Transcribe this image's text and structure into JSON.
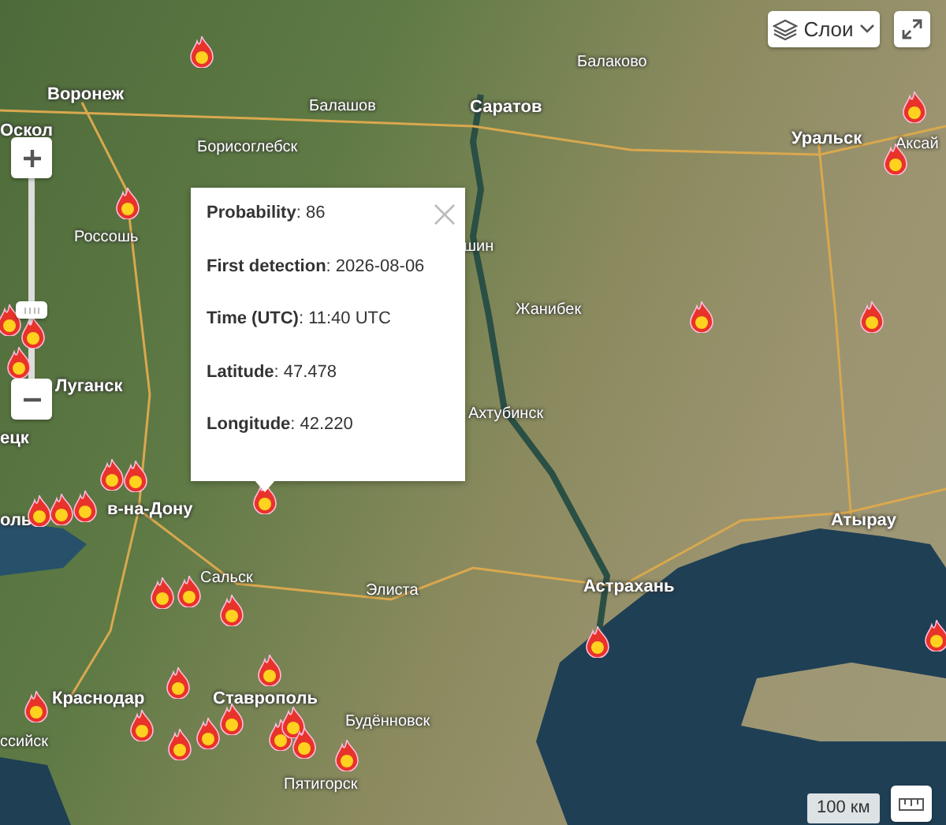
{
  "map": {
    "labels": [
      {
        "text": "Воронеж",
        "kind": "major"
      },
      {
        "text": "Оскол",
        "kind": "major"
      },
      {
        "text": "Балашов",
        "kind": "minor"
      },
      {
        "text": "Борисоглебск",
        "kind": "minor"
      },
      {
        "text": "Саратов",
        "kind": "major"
      },
      {
        "text": "Балаково",
        "kind": "minor"
      },
      {
        "text": "Уральск",
        "kind": "major"
      },
      {
        "text": "Аксай",
        "kind": "minor"
      },
      {
        "text": "Россошь",
        "kind": "minor"
      },
      {
        "text": "Луганск",
        "kind": "major"
      },
      {
        "text": "шин",
        "kind": "minor"
      },
      {
        "text": "Жанибек",
        "kind": "minor"
      },
      {
        "text": "Ахтубинск",
        "kind": "minor"
      },
      {
        "text": "Атырау",
        "kind": "major"
      },
      {
        "text": "Астрахань",
        "kind": "major"
      },
      {
        "text": "ецк",
        "kind": "major"
      },
      {
        "text": "оль",
        "kind": "major"
      },
      {
        "text": "в-на-Дону",
        "kind": "major"
      },
      {
        "text": "Сальск",
        "kind": "minor"
      },
      {
        "text": "Элиста",
        "kind": "minor"
      },
      {
        "text": "Краснодар",
        "kind": "major"
      },
      {
        "text": "ссийск",
        "kind": "minor"
      },
      {
        "text": "Ставрополь",
        "kind": "major"
      },
      {
        "text": "Будённовск",
        "kind": "minor"
      },
      {
        "text": "Пятигорск",
        "kind": "minor"
      }
    ]
  },
  "popup": {
    "fields": [
      {
        "text": "**Probability**: 86"
      },
      {
        "text": "**First detection**: 2026-08-06"
      },
      {
        "text": "**Time (UTC)**: 11:40 UTC"
      },
      {
        "text": "**Latitude**: 47.478"
      },
      {
        "text": "**Longitude**: 42.220"
      }
    ]
  },
  "controls": {
    "layers_button": "Слои",
    "scale": "100 км"
  }
}
